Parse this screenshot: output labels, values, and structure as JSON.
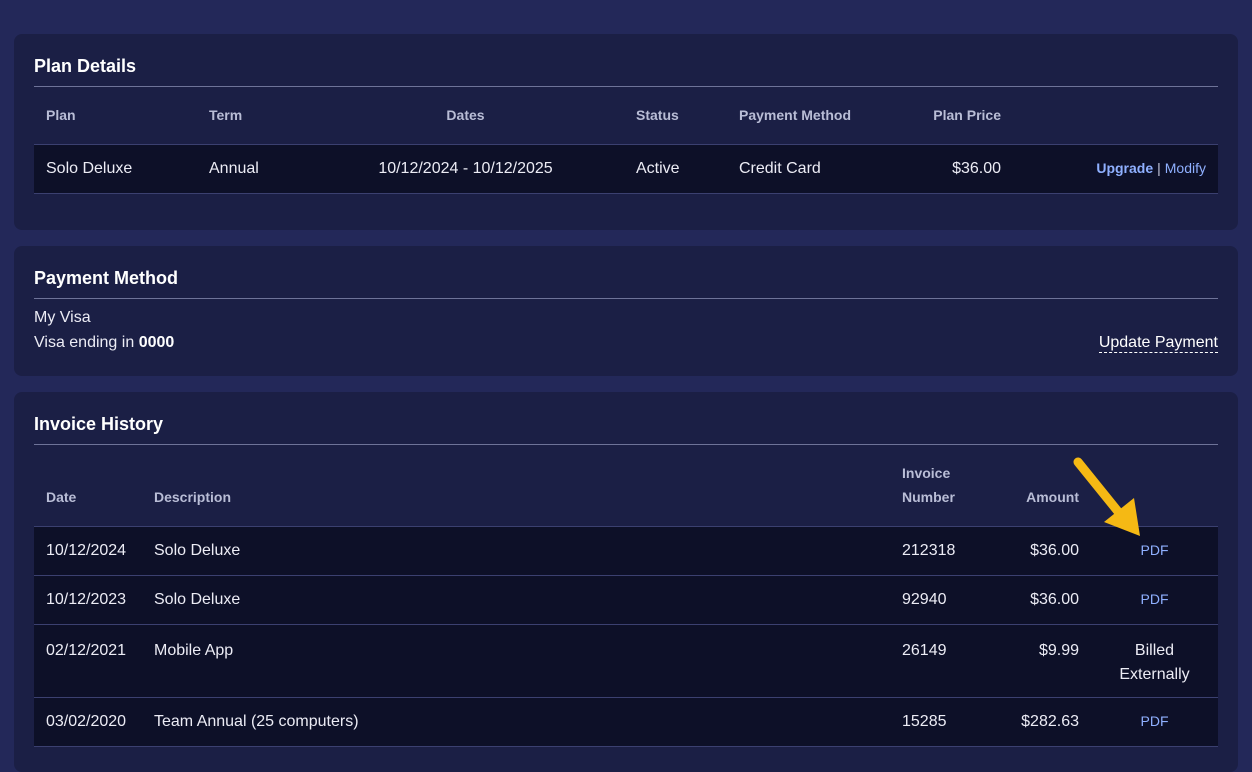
{
  "plan": {
    "title": "Plan Details",
    "headers": {
      "plan": "Plan",
      "term": "Term",
      "dates": "Dates",
      "status": "Status",
      "payment_method": "Payment Method",
      "plan_price": "Plan Price"
    },
    "row": {
      "plan": "Solo Deluxe",
      "term": "Annual",
      "dates": "10/12/2024 - 10/12/2025",
      "status": "Active",
      "payment_method": "Credit Card",
      "plan_price": "$36.00",
      "upgrade_label": "Upgrade",
      "separator": "|",
      "modify_label": "Modify"
    }
  },
  "payment": {
    "title": "Payment Method",
    "card_name": "My Visa",
    "ending_prefix": "Visa ending in",
    "ending_digits": "0000",
    "update_label": "Update Payment"
  },
  "invoices": {
    "title": "Invoice History",
    "headers": {
      "date": "Date",
      "description": "Description",
      "invoice_number_line1": "Invoice",
      "invoice_number_line2": "Number",
      "amount": "Amount"
    },
    "rows": [
      {
        "date": "10/12/2024",
        "description": "Solo Deluxe",
        "number": "212318",
        "amount": "$36.00",
        "action": "PDF"
      },
      {
        "date": "10/12/2023",
        "description": "Solo Deluxe",
        "number": "92940",
        "amount": "$36.00",
        "action": "PDF"
      },
      {
        "date": "02/12/2021",
        "description": "Mobile App",
        "number": "26149",
        "amount": "$9.99",
        "action_line1": "Billed",
        "action_line2": "Externally"
      },
      {
        "date": "03/02/2020",
        "description": "Team Annual (25 computers)",
        "number": "15285",
        "amount": "$282.63",
        "action": "PDF"
      }
    ]
  },
  "colors": {
    "page_bg": "#232859",
    "card_bg": "#1b1f45",
    "row_bg": "#0d1028",
    "link": "#8fb0ff",
    "arrow": "#f5b914"
  },
  "annotation": {
    "icon": "arrow-pointer-icon"
  }
}
